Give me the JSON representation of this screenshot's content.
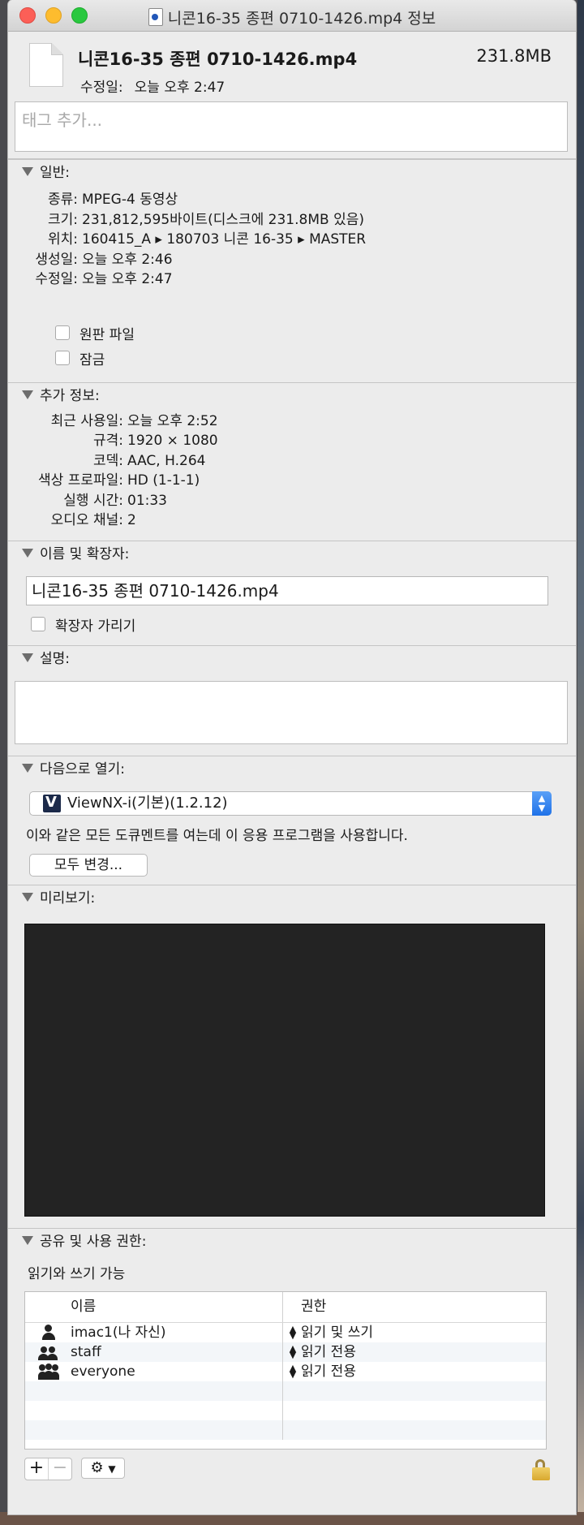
{
  "window": {
    "title": "니콘16-35 종편 0710-1426.mp4 정보"
  },
  "header": {
    "filename": "니콘16-35 종편 0710-1426.mp4",
    "size": "231.8MB",
    "modified_label": "수정일:",
    "modified_value": "오늘 오후 2:47"
  },
  "tags": {
    "placeholder": "태그 추가..."
  },
  "general": {
    "title": "일반:",
    "rows": [
      {
        "k": "종류:",
        "v": "MPEG-4 동영상"
      },
      {
        "k": "크기:",
        "v": "231,812,595바이트(디스크에 231.8MB 있음)"
      },
      {
        "k": "위치:",
        "v": "160415_A ▸ 180703 니콘 16-35 ▸ MASTER"
      },
      {
        "k": "생성일:",
        "v": "오늘 오후 2:46"
      },
      {
        "k": "수정일:",
        "v": "오늘 오후 2:47"
      }
    ],
    "stationery": "원판 파일",
    "locked": "잠금"
  },
  "more": {
    "title": "추가 정보:",
    "rows": [
      {
        "k": "최근 사용일:",
        "v": "오늘 오후 2:52"
      },
      {
        "k": "규격:",
        "v": "1920 × 1080"
      },
      {
        "k": "코덱:",
        "v": "AAC, H.264"
      },
      {
        "k": "색상 프로파일:",
        "v": "HD (1-1-1)"
      },
      {
        "k": "실행 시간:",
        "v": "01:33"
      },
      {
        "k": "오디오 채널:",
        "v": "2"
      }
    ]
  },
  "name_ext": {
    "title": "이름 및 확장자:",
    "value": "니콘16-35 종편 0710-1426.mp4",
    "hide_ext": "확장자 가리기"
  },
  "comments": {
    "title": "설명:"
  },
  "open_with": {
    "title": "다음으로 열기:",
    "app": "ViewNX-i(기본)(1.2.12)",
    "hint": "이와 같은 모든 도큐멘트를 여는데 이 응용 프로그램을 사용합니다.",
    "change_all": "모두 변경..."
  },
  "preview": {
    "title": "미리보기:"
  },
  "sharing": {
    "title": "공유 및 사용 권한:",
    "status": "읽기와 쓰기 가능",
    "col_name": "이름",
    "col_priv": "권한",
    "rows": [
      {
        "name": "imac1(나 자신)",
        "priv": "읽기 및 쓰기",
        "icon": "single-user-icon"
      },
      {
        "name": "staff",
        "priv": "읽기 전용",
        "icon": "group-icon"
      },
      {
        "name": "everyone",
        "priv": "읽기 전용",
        "icon": "everyone-icon"
      }
    ],
    "add": "+",
    "remove": "−"
  }
}
